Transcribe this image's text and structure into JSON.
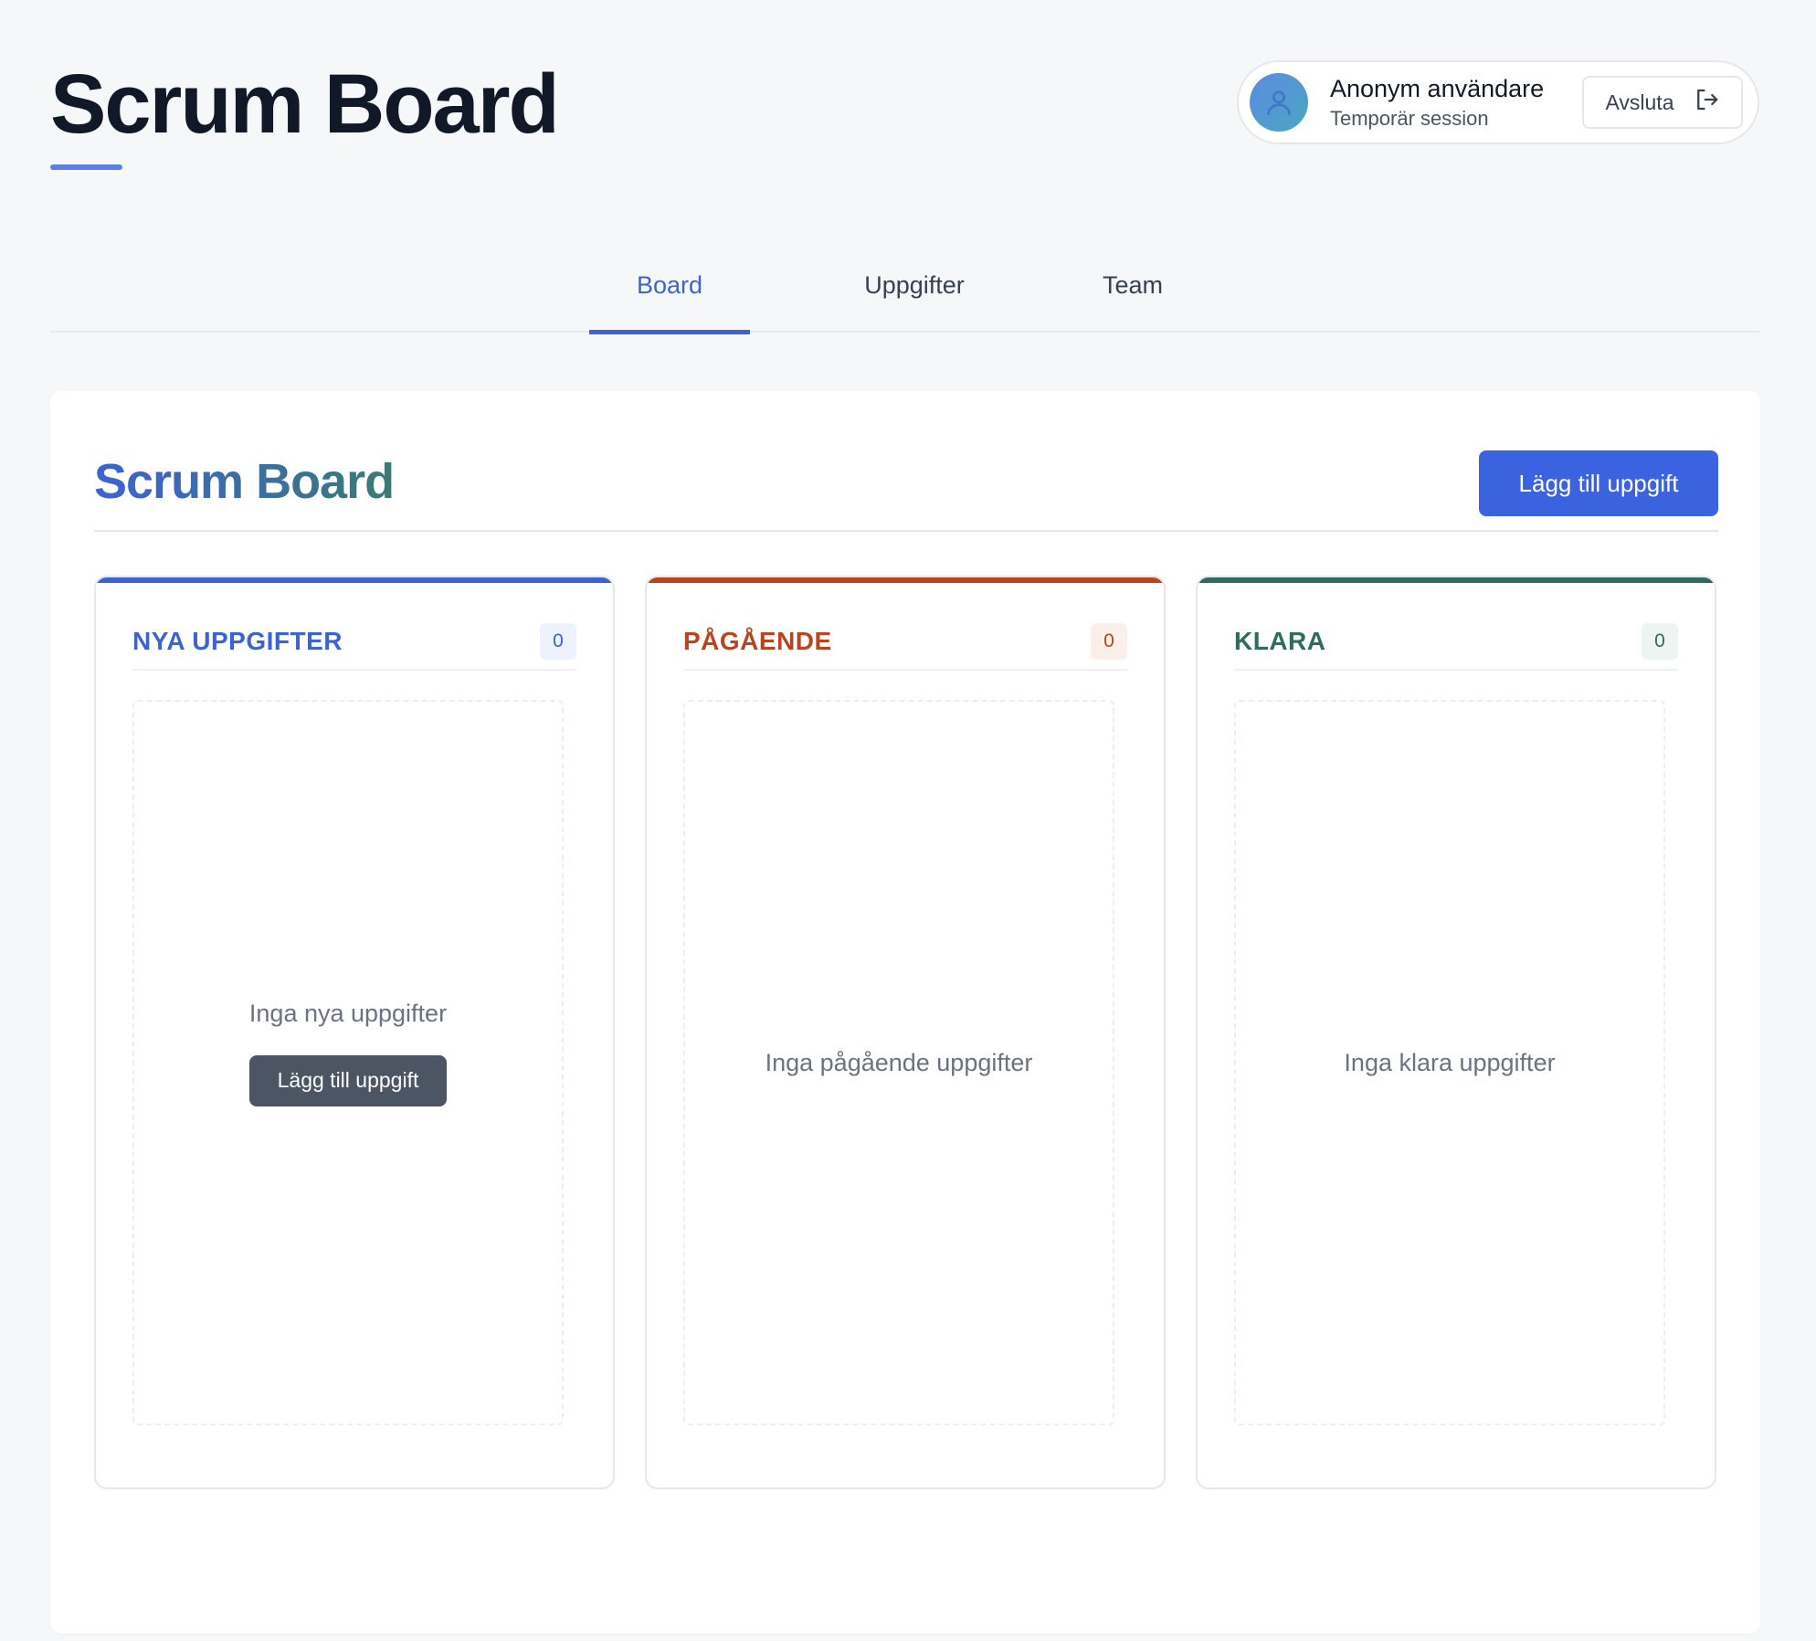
{
  "header": {
    "title": "Scrum Board",
    "user": {
      "name": "Anonym användare",
      "session": "Temporär session",
      "logout_label": "Avsluta"
    }
  },
  "tabs": [
    {
      "label": "Board",
      "active": true
    },
    {
      "label": "Uppgifter",
      "active": false
    },
    {
      "label": "Team",
      "active": false
    }
  ],
  "board": {
    "heading": "Scrum Board",
    "add_task_label": "Lägg till uppgift",
    "columns": [
      {
        "title": "NYA UPPGIFTER",
        "count": "0",
        "empty_text": "Inga nya uppgifter",
        "add_label": "Lägg till uppgift",
        "color": "#3b63d1",
        "badge_bg": "#eef2fc"
      },
      {
        "title": "PÅGÅENDE",
        "count": "0",
        "empty_text": "Inga pågående uppgifter",
        "color": "#b8451f",
        "badge_bg": "#fbefea"
      },
      {
        "title": "KLARA",
        "count": "0",
        "empty_text": "Inga klara uppgifter",
        "color": "#2f6b5e",
        "badge_bg": "#edf4f2"
      }
    ]
  },
  "colors": {
    "accent": "#3b63e0",
    "underline": "#5b7fe4",
    "background": "#f6f7f9"
  }
}
